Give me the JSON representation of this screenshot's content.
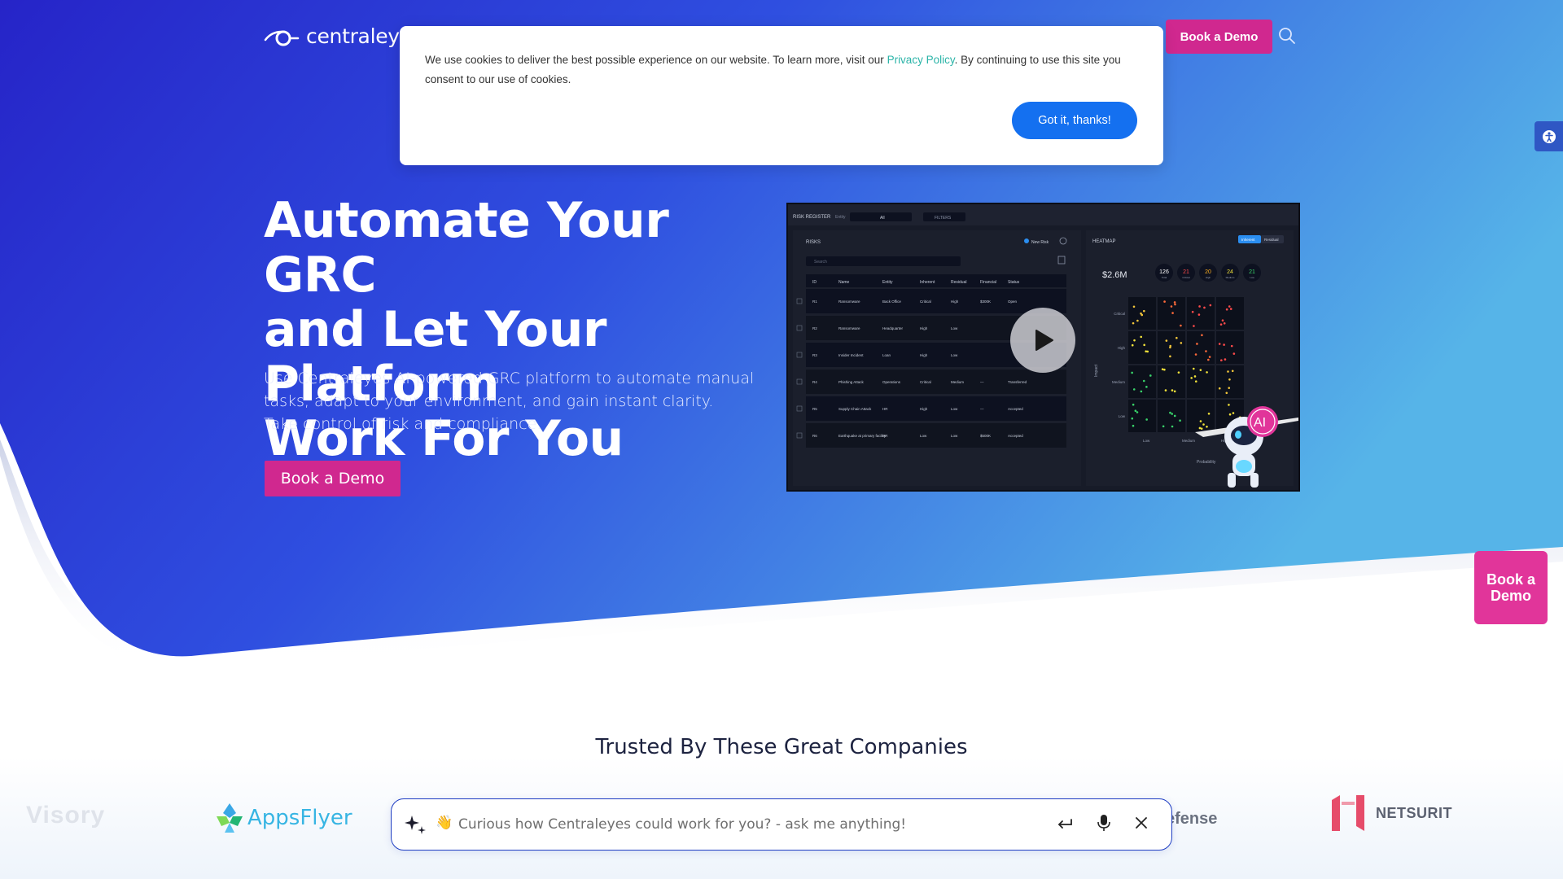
{
  "header": {
    "logo_text": "centraleyes",
    "demo_button": "Book a Demo"
  },
  "cookie_banner": {
    "text_before_link": "We use cookies to deliver the best possible experience on our website. To learn more, visit our ",
    "link_text": "Privacy Policy",
    "text_after_link": ". By continuing to use this site you consent to our use of cookies.",
    "accept_button": "Got it, thanks!"
  },
  "hero": {
    "title_lines": [
      "Automate Your GRC",
      "and Let Your Platform",
      "Work For You"
    ],
    "subtitle_lines": [
      "Use Centraleyes AI-powered GRC platform to automate manual",
      "tasks, adapt to your environment, and gain instant clarity.",
      "Take control of risk and compliance."
    ],
    "demo_button": "Book a Demo"
  },
  "video_preview": {
    "panel_title": "RISK REGISTER",
    "entity_label": "Entity",
    "entity_value": "All",
    "filters_label": "FILTERS",
    "risks_title": "RISKS",
    "new_risk_label": "New Risk",
    "search_placeholder": "Search",
    "table_headers": [
      "ID",
      "Name",
      "Entity",
      "Inherent",
      "Residual",
      "Financial",
      "Status"
    ],
    "rows": [
      {
        "id": "R1",
        "name": "Ransomware",
        "entity": "Back Office",
        "inherent": "Critical",
        "residual": "High",
        "financial": "$300K",
        "status": "Open"
      },
      {
        "id": "R2",
        "name": "Ransomware",
        "entity": "Headquarter",
        "inherent": "High",
        "residual": "Low",
        "financial": "",
        "status": ""
      },
      {
        "id": "R3",
        "name": "Insider Incident",
        "entity": "Loan",
        "inherent": "High",
        "residual": "Low",
        "financial": "",
        "status": ""
      },
      {
        "id": "R4",
        "name": "Phishing Attack",
        "entity": "Operations",
        "inherent": "Critical",
        "residual": "Medium",
        "financial": "—",
        "status": "Transferred"
      },
      {
        "id": "R5",
        "name": "Supply Chain Attack",
        "entity": "HR",
        "inherent": "High",
        "residual": "Low",
        "financial": "—",
        "status": "Accepted"
      },
      {
        "id": "R6",
        "name": "Earthquake at primary facility",
        "entity": "HR",
        "inherent": "Low",
        "residual": "Low",
        "financial": "$500K",
        "status": "Accepted"
      }
    ],
    "heatmap_title": "HEATMAP",
    "toggle_a": "Inherent",
    "toggle_b": "Residual",
    "total_value": "$2.6M",
    "counts": [
      {
        "value": "126",
        "label": "Total",
        "color": "#ffffff"
      },
      {
        "value": "21",
        "label": "Critical",
        "color": "#ff4a4a"
      },
      {
        "value": "20",
        "label": "High",
        "color": "#ffb020"
      },
      {
        "value": "24",
        "label": "Medium",
        "color": "#f2e23a"
      },
      {
        "value": "21",
        "label": "Low",
        "color": "#39d36a"
      }
    ],
    "y_axis": [
      "Critical",
      "High",
      "Medium",
      "Low"
    ],
    "x_axis": [
      "Low",
      "Medium",
      "High"
    ],
    "impact_label": "Impact",
    "probability_label": "Probability",
    "ai_badge": "AI"
  },
  "floating_demo": "Book a Demo",
  "trusted": {
    "title": "Trusted By These Great Companies",
    "brands": [
      "Visory",
      "AppsFlyer",
      "efense",
      "NETSURIT"
    ]
  },
  "chat": {
    "emoji": "👋",
    "placeholder": "Curious how Centraleyes could work for you? - ask me anything!"
  },
  "colors": {
    "brand_pink": "#d0288f",
    "cookie_button": "#1470f0",
    "hero_blue_dark": "#2a2fd0",
    "hero_blue_light": "#4fa9e4",
    "link_teal": "#2bb4a8"
  }
}
